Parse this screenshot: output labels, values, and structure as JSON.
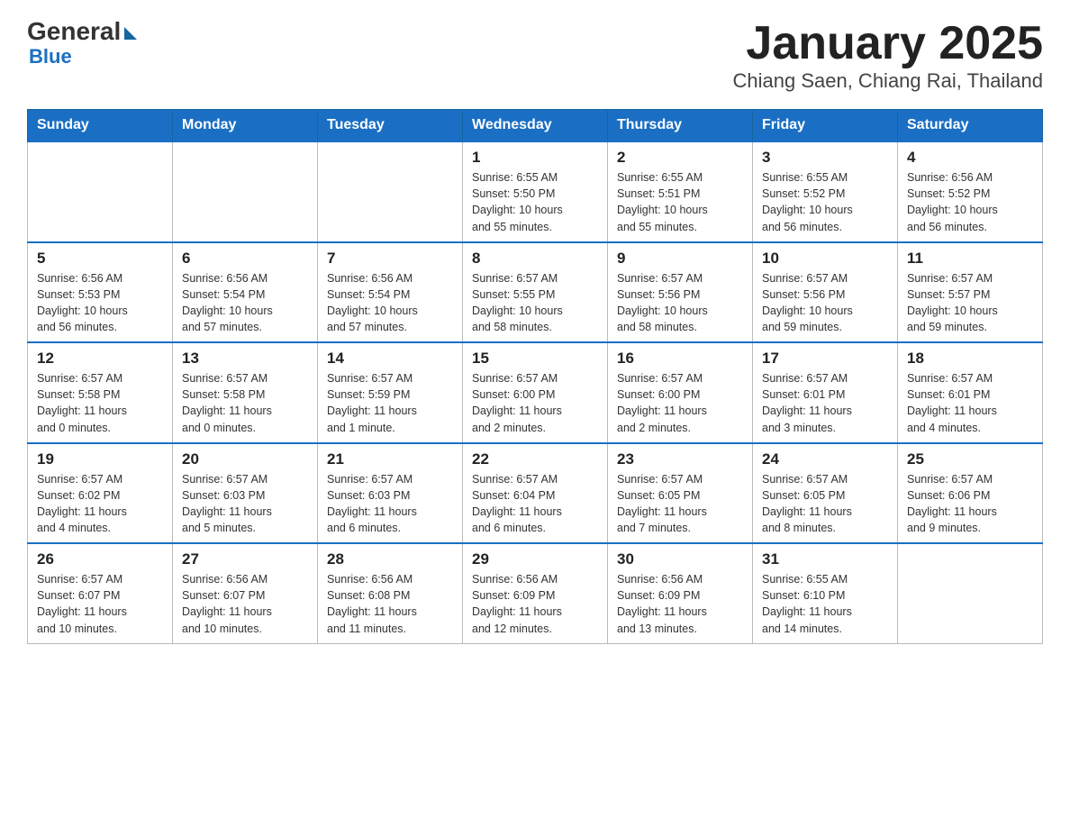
{
  "header": {
    "logo_text": "General",
    "logo_blue": "Blue",
    "title": "January 2025",
    "subtitle": "Chiang Saen, Chiang Rai, Thailand"
  },
  "weekdays": [
    "Sunday",
    "Monday",
    "Tuesday",
    "Wednesday",
    "Thursday",
    "Friday",
    "Saturday"
  ],
  "weeks": [
    [
      {
        "day": "",
        "info": ""
      },
      {
        "day": "",
        "info": ""
      },
      {
        "day": "",
        "info": ""
      },
      {
        "day": "1",
        "info": "Sunrise: 6:55 AM\nSunset: 5:50 PM\nDaylight: 10 hours\nand 55 minutes."
      },
      {
        "day": "2",
        "info": "Sunrise: 6:55 AM\nSunset: 5:51 PM\nDaylight: 10 hours\nand 55 minutes."
      },
      {
        "day": "3",
        "info": "Sunrise: 6:55 AM\nSunset: 5:52 PM\nDaylight: 10 hours\nand 56 minutes."
      },
      {
        "day": "4",
        "info": "Sunrise: 6:56 AM\nSunset: 5:52 PM\nDaylight: 10 hours\nand 56 minutes."
      }
    ],
    [
      {
        "day": "5",
        "info": "Sunrise: 6:56 AM\nSunset: 5:53 PM\nDaylight: 10 hours\nand 56 minutes."
      },
      {
        "day": "6",
        "info": "Sunrise: 6:56 AM\nSunset: 5:54 PM\nDaylight: 10 hours\nand 57 minutes."
      },
      {
        "day": "7",
        "info": "Sunrise: 6:56 AM\nSunset: 5:54 PM\nDaylight: 10 hours\nand 57 minutes."
      },
      {
        "day": "8",
        "info": "Sunrise: 6:57 AM\nSunset: 5:55 PM\nDaylight: 10 hours\nand 58 minutes."
      },
      {
        "day": "9",
        "info": "Sunrise: 6:57 AM\nSunset: 5:56 PM\nDaylight: 10 hours\nand 58 minutes."
      },
      {
        "day": "10",
        "info": "Sunrise: 6:57 AM\nSunset: 5:56 PM\nDaylight: 10 hours\nand 59 minutes."
      },
      {
        "day": "11",
        "info": "Sunrise: 6:57 AM\nSunset: 5:57 PM\nDaylight: 10 hours\nand 59 minutes."
      }
    ],
    [
      {
        "day": "12",
        "info": "Sunrise: 6:57 AM\nSunset: 5:58 PM\nDaylight: 11 hours\nand 0 minutes."
      },
      {
        "day": "13",
        "info": "Sunrise: 6:57 AM\nSunset: 5:58 PM\nDaylight: 11 hours\nand 0 minutes."
      },
      {
        "day": "14",
        "info": "Sunrise: 6:57 AM\nSunset: 5:59 PM\nDaylight: 11 hours\nand 1 minute."
      },
      {
        "day": "15",
        "info": "Sunrise: 6:57 AM\nSunset: 6:00 PM\nDaylight: 11 hours\nand 2 minutes."
      },
      {
        "day": "16",
        "info": "Sunrise: 6:57 AM\nSunset: 6:00 PM\nDaylight: 11 hours\nand 2 minutes."
      },
      {
        "day": "17",
        "info": "Sunrise: 6:57 AM\nSunset: 6:01 PM\nDaylight: 11 hours\nand 3 minutes."
      },
      {
        "day": "18",
        "info": "Sunrise: 6:57 AM\nSunset: 6:01 PM\nDaylight: 11 hours\nand 4 minutes."
      }
    ],
    [
      {
        "day": "19",
        "info": "Sunrise: 6:57 AM\nSunset: 6:02 PM\nDaylight: 11 hours\nand 4 minutes."
      },
      {
        "day": "20",
        "info": "Sunrise: 6:57 AM\nSunset: 6:03 PM\nDaylight: 11 hours\nand 5 minutes."
      },
      {
        "day": "21",
        "info": "Sunrise: 6:57 AM\nSunset: 6:03 PM\nDaylight: 11 hours\nand 6 minutes."
      },
      {
        "day": "22",
        "info": "Sunrise: 6:57 AM\nSunset: 6:04 PM\nDaylight: 11 hours\nand 6 minutes."
      },
      {
        "day": "23",
        "info": "Sunrise: 6:57 AM\nSunset: 6:05 PM\nDaylight: 11 hours\nand 7 minutes."
      },
      {
        "day": "24",
        "info": "Sunrise: 6:57 AM\nSunset: 6:05 PM\nDaylight: 11 hours\nand 8 minutes."
      },
      {
        "day": "25",
        "info": "Sunrise: 6:57 AM\nSunset: 6:06 PM\nDaylight: 11 hours\nand 9 minutes."
      }
    ],
    [
      {
        "day": "26",
        "info": "Sunrise: 6:57 AM\nSunset: 6:07 PM\nDaylight: 11 hours\nand 10 minutes."
      },
      {
        "day": "27",
        "info": "Sunrise: 6:56 AM\nSunset: 6:07 PM\nDaylight: 11 hours\nand 10 minutes."
      },
      {
        "day": "28",
        "info": "Sunrise: 6:56 AM\nSunset: 6:08 PM\nDaylight: 11 hours\nand 11 minutes."
      },
      {
        "day": "29",
        "info": "Sunrise: 6:56 AM\nSunset: 6:09 PM\nDaylight: 11 hours\nand 12 minutes."
      },
      {
        "day": "30",
        "info": "Sunrise: 6:56 AM\nSunset: 6:09 PM\nDaylight: 11 hours\nand 13 minutes."
      },
      {
        "day": "31",
        "info": "Sunrise: 6:55 AM\nSunset: 6:10 PM\nDaylight: 11 hours\nand 14 minutes."
      },
      {
        "day": "",
        "info": ""
      }
    ]
  ]
}
